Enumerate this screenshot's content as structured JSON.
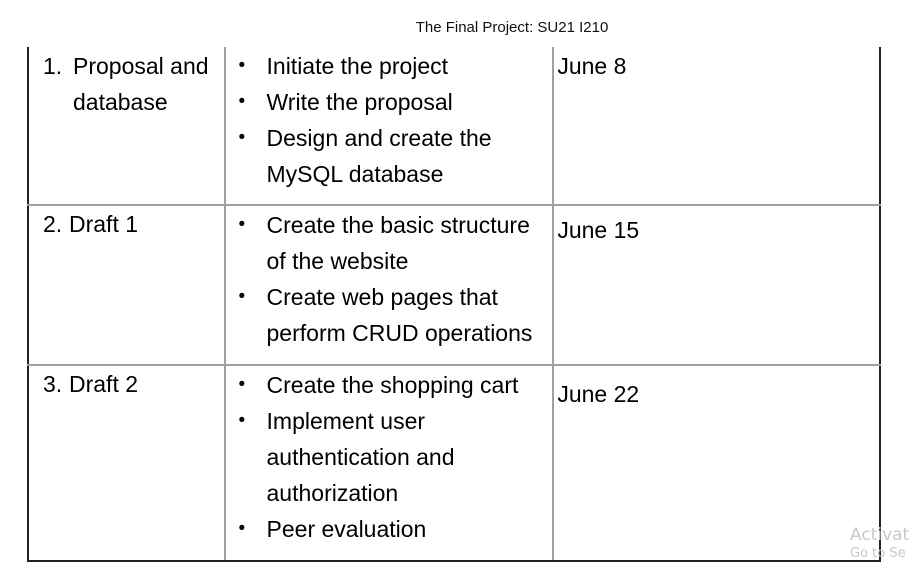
{
  "header": {
    "title": "The Final Project: SU21 I210"
  },
  "rows": [
    {
      "num": "1.",
      "phase": "Proposal and database",
      "tasks": [
        "Initiate the project",
        "Write the proposal",
        "Design and create the MySQL database"
      ],
      "date": "June 8"
    },
    {
      "num": "2.",
      "phase": "Draft 1",
      "tasks": [
        "Create the basic structure of the website",
        "Create web pages that perform CRUD operations"
      ],
      "date": "June 15"
    },
    {
      "num": "3.",
      "phase": "Draft 2",
      "tasks": [
        "Create the shopping cart",
        "Implement user authentication and authorization",
        "Peer evaluation"
      ],
      "date": "June 22"
    }
  ],
  "bullet_glyph": "•",
  "watermark": {
    "line1": "Activat",
    "line2": "Go to Se"
  }
}
